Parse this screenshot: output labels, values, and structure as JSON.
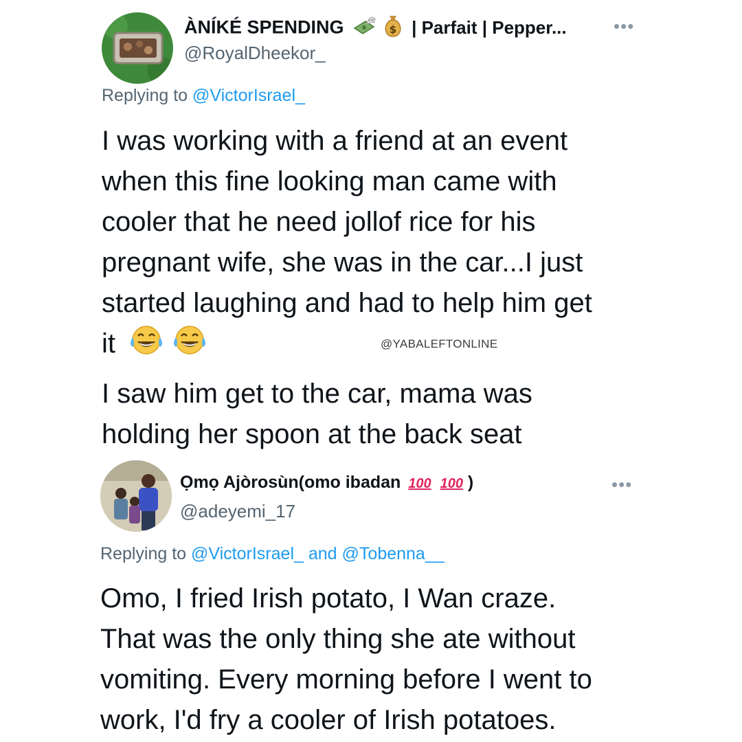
{
  "tweet1": {
    "display_name": "ÀNÍKÉ SPENDING",
    "name_suffix": "| Parfait | Pepper...",
    "handle": "@RoyalDheekor_",
    "more_icon": "•••",
    "reply_prefix": "Replying to",
    "reply_to": "@VictorIsrael_",
    "paragraph1_lines": [
      "I was working with a friend at an event",
      "when this fine looking man came with",
      "cooler that he need jollof rice for his",
      "pregnant wife, she was in the car...I just",
      "started laughing and had to help him get"
    ],
    "paragraph1_last": "it",
    "paragraph2_lines": [
      "I saw him get to the car, mama was",
      "holding her spoon at the back seat"
    ],
    "icons": [
      "money-with-wings-icon",
      "money-bag-icon",
      "laughing-tears-emoji"
    ]
  },
  "watermark": "@YABALEFTONLINE",
  "tweet2": {
    "display_name": "Ọmọ Ajòrosùn(omo ibadan",
    "badge": "100",
    "name_close": ")",
    "handle": "@adeyemi_17",
    "more_icon": "•••",
    "reply_prefix": "Replying to",
    "reply_to_1": "@VictorIsrael_",
    "reply_and": "and",
    "reply_to_2": "@Tobenna__",
    "body_lines": [
      "Omo, I fried Irish potato, I Wan craze.",
      "That was the only thing she ate without",
      "vomiting. Every morning before I went to",
      "work, I'd fry a cooler of Irish potatoes."
    ]
  },
  "colors": {
    "text": "#0f1419",
    "secondary": "#536471",
    "link": "#1d9bf0",
    "hundred_red": "#e0245e"
  }
}
